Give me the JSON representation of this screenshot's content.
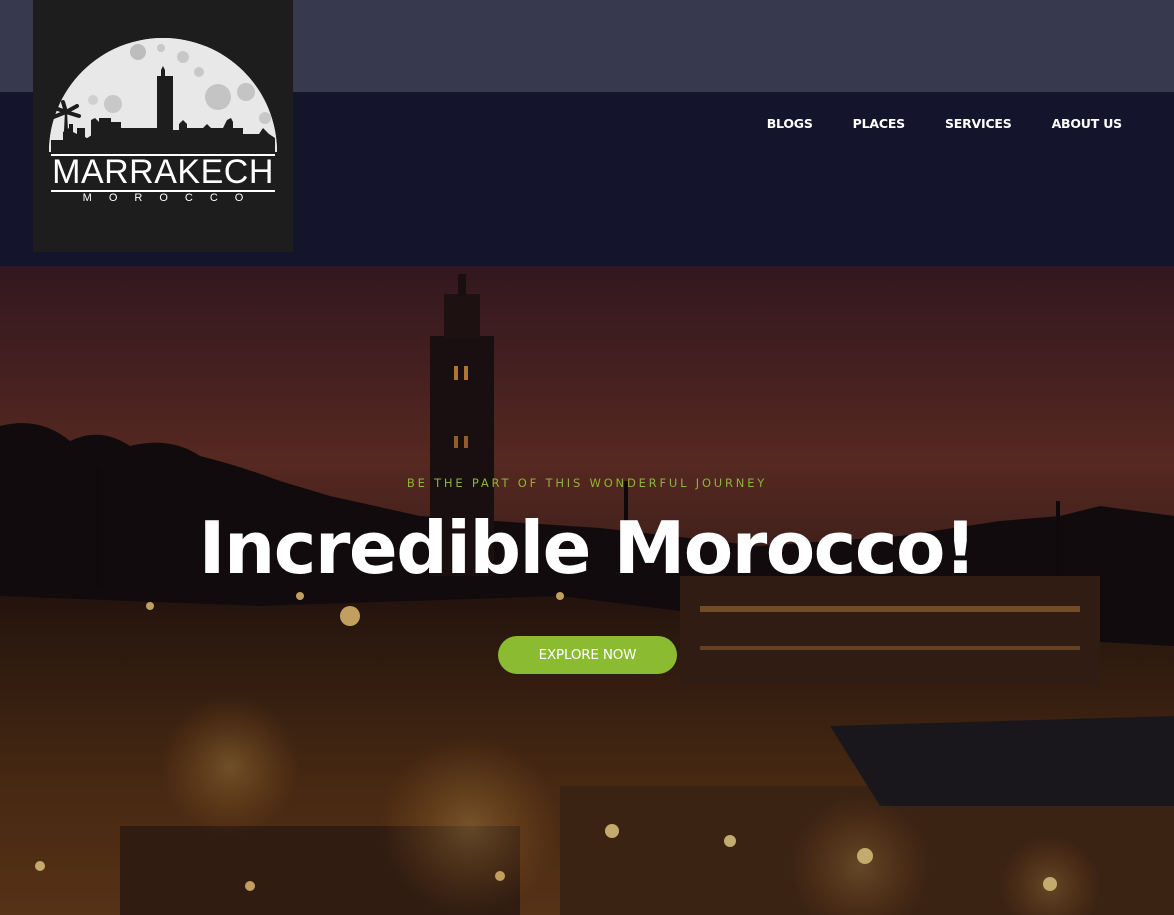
{
  "brand": {
    "name": "MARRAKECH",
    "subtitle": "MOROCCO",
    "logo_icon": "moon-skyline-logo"
  },
  "nav": {
    "items": [
      {
        "label": "BLOGS"
      },
      {
        "label": "PLACES"
      },
      {
        "label": "SERVICES"
      },
      {
        "label": "ABOUT US"
      }
    ]
  },
  "hero": {
    "tagline": "BE THE PART OF THIS WONDERFUL JOURNEY",
    "headline": "Incredible Morocco!",
    "cta_label": "EXPLORE NOW"
  },
  "colors": {
    "accent": "#8bbb31",
    "topbar": "#373a4e",
    "navband": "#14142c",
    "logo_bg": "#1d1d1d"
  }
}
